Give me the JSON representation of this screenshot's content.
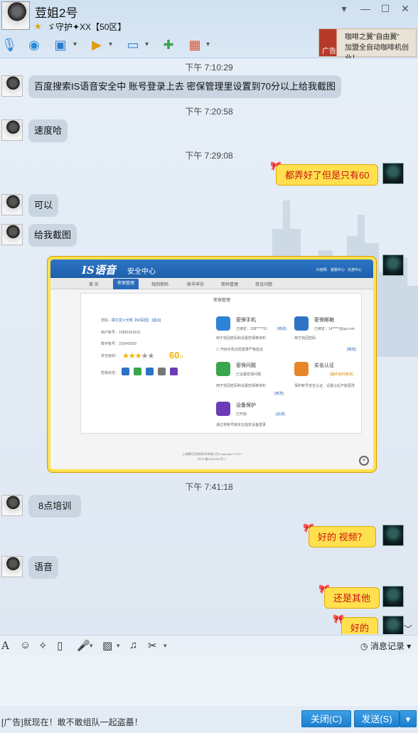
{
  "header": {
    "contact_name": "荳姐2号",
    "contact_status": "ゞ守护✦XX【50区】",
    "window_buttons": [
      "▾",
      "—",
      "☐",
      "✕"
    ]
  },
  "toolbar": {
    "icons": [
      "microphone-icon",
      "webcam-icon",
      "screen-share-icon",
      "file-transfer-icon",
      "remote-desktop-icon",
      "add-chat-icon",
      "apps-icon"
    ]
  },
  "ad": {
    "line1": "咖啡之翼”自由翼”",
    "line2": "加盟全自动咖啡机创业！",
    "tag": "广告"
  },
  "messages": [
    {
      "kind": "time",
      "text": "下午 7:10:29"
    },
    {
      "kind": "in",
      "text": "百度搜索IS语音安全中 账号登录上去 密保管理里设置到70分以上给我截图"
    },
    {
      "kind": "time",
      "text": "下午 7:20:58"
    },
    {
      "kind": "in",
      "text": "速度哈"
    },
    {
      "kind": "time",
      "text": "下午 7:29:08"
    },
    {
      "kind": "out",
      "text": "都弄好了但是只有60"
    },
    {
      "kind": "in",
      "text": "可以"
    },
    {
      "kind": "in",
      "text": "给我截图"
    },
    {
      "kind": "time",
      "text": "下午 7:41:18"
    },
    {
      "kind": "in",
      "text": "8点培训"
    },
    {
      "kind": "out",
      "text": "好的  视频？"
    },
    {
      "kind": "in",
      "text": "语音"
    },
    {
      "kind": "out",
      "text": "还是其他"
    },
    {
      "kind": "out",
      "text": "好的"
    }
  ],
  "screenshot": {
    "logo": "IS语音",
    "subtitle": "安全中心",
    "top_links": [
      "IS官网",
      "客服中心",
      "先游中心"
    ],
    "nav": [
      "首 页",
      "密保管理",
      "找回密码",
      "帐号申诉",
      "密码管理",
      "常见问题"
    ],
    "panel_title": "密保管理",
    "greeting": "您好，",
    "user_tag": "耶文爱♔光明【50军团】",
    "logout": "[退出]",
    "account_label": "用户帐号：15881653615",
    "number_label": "数字帐号：310642009",
    "level_label": "安全级别：",
    "score": "60",
    "score_unit": "分",
    "status_label": "密保状态：",
    "items": [
      {
        "title": "密保手机",
        "desc": "已绑定：158*****15",
        "link": "[修改]",
        "sub": "用于找回密码和设置密保等资料"
      },
      {
        "title": "密保邮箱",
        "desc": "已绑定：14*****@qq.com",
        "link": "[修改]",
        "sub": "用于找回密码"
      },
      {
        "title": "密保问题",
        "desc": "已设置密保问题",
        "link": "[修改]",
        "sub": "用于找回密码和设置密保等资料"
      },
      {
        "title": "实名认证",
        "desc": "保护帐号安全",
        "link": "[最终资料修改]",
        "sub": "保护帐号安全认证，设置以后不能更改"
      },
      {
        "title": "设备保护",
        "desc": "已开启",
        "link": "[关闭]",
        "sub": "通过将帐号锁定在指定设备登录"
      }
    ],
    "checkbox_text": "开启手机动态登录严格验证",
    "footer1": "上海颤科互联网技术有限公司 Copyright © 2017",
    "footer2": "沪ICP备13024343号-1"
  },
  "input_toolbar": {
    "history_label": "消息记录",
    "icons": [
      "font-icon",
      "emoji-icon",
      "magic-icon",
      "screenshot-icon",
      "voice-message-icon",
      "image-icon",
      "music-icon",
      "scissors-icon"
    ]
  },
  "bottom": {
    "ad_text": "[广告]就现在！敢不敢组队一起盗墓！",
    "close_label": "关闭(C)",
    "send_label": "发送(S)"
  }
}
